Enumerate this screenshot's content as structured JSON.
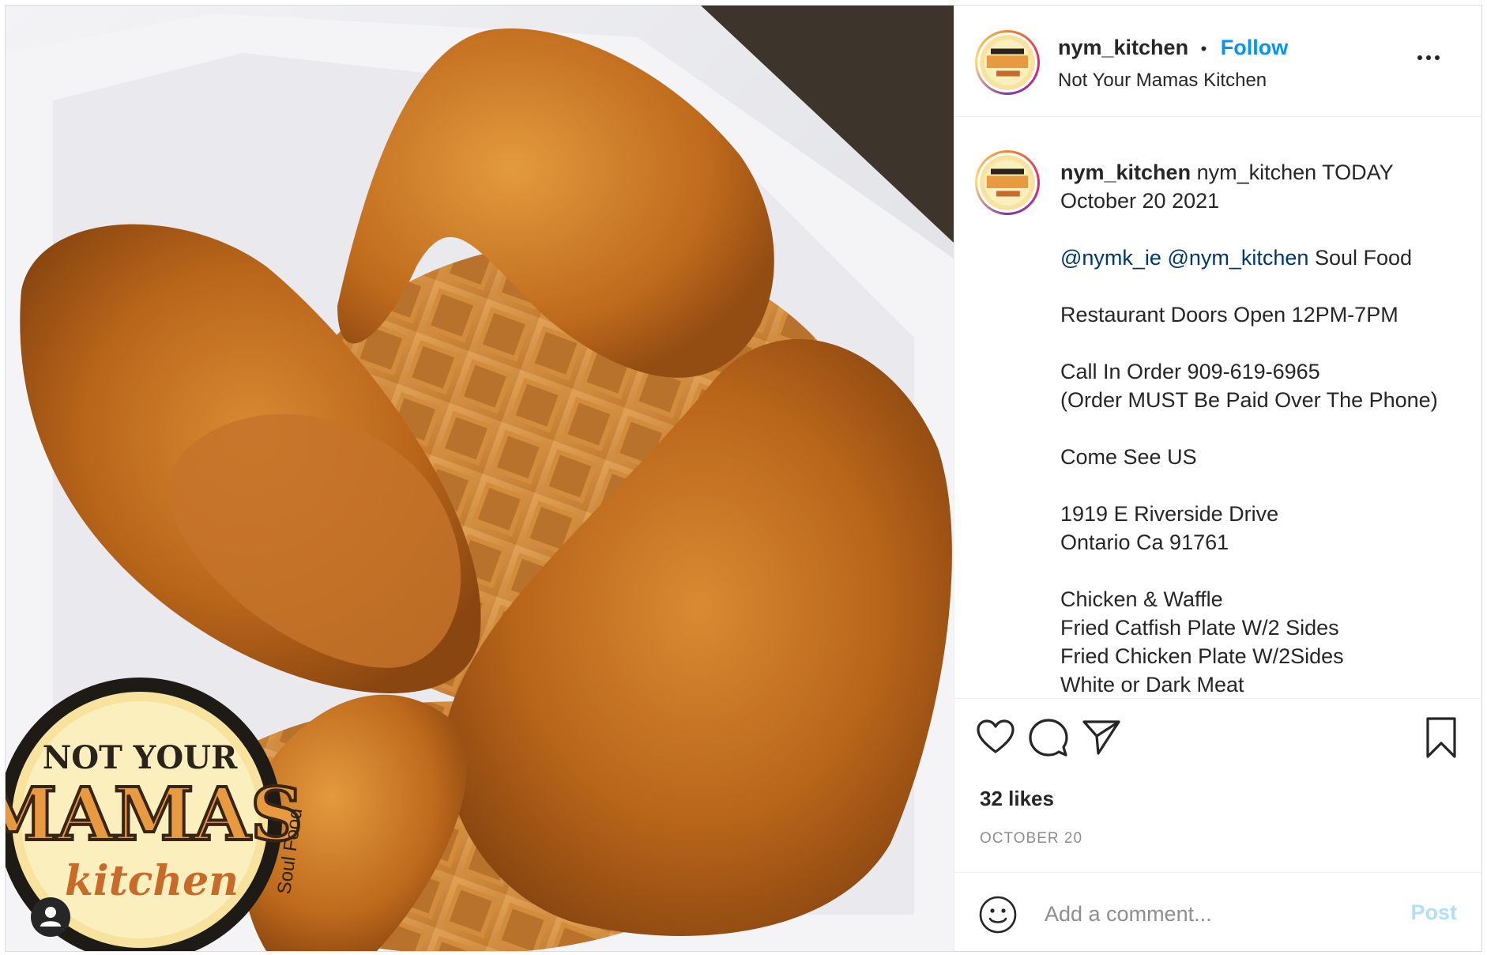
{
  "header": {
    "username": "nym_kitchen",
    "separator": "•",
    "follow_label": "Follow",
    "subtitle": "Not Your Mamas Kitchen"
  },
  "logo": {
    "line1": "NOT YOUR",
    "line2": "MAMAS",
    "line3": "kitchen",
    "side_text": "Soul Food"
  },
  "caption": {
    "username": "nym_kitchen",
    "lines": [
      "nym_kitchen TODAY",
      "October 20 2021",
      "",
      "",
      "Soul Food",
      "",
      "Restaurant Doors Open 12PM-7PM",
      "",
      "Call In Order 909-619-6965",
      "(Order MUST Be Paid Over The Phone)",
      "",
      "Come See US",
      "",
      "1919 E Riverside Drive",
      "Ontario Ca 91761",
      "",
      "Chicken & Waffle",
      "Fried Catfish Plate W/2 Sides",
      "Fried Chicken Plate W/2Sides",
      "White or Dark Meat"
    ],
    "mention1": "@nymk_ie",
    "mention2": "@nym_kitchen"
  },
  "actions": {
    "icons": [
      "heart-icon",
      "comment-icon",
      "share-icon",
      "bookmark-icon"
    ]
  },
  "likes": "32 likes",
  "date": "OCTOBER 20",
  "comment": {
    "placeholder": "Add a comment...",
    "post_label": "Post"
  },
  "colors": {
    "follow": "#0095f6",
    "mention": "#00376b",
    "post_disabled": "#b2dffc",
    "muted": "#8e8e8e"
  }
}
